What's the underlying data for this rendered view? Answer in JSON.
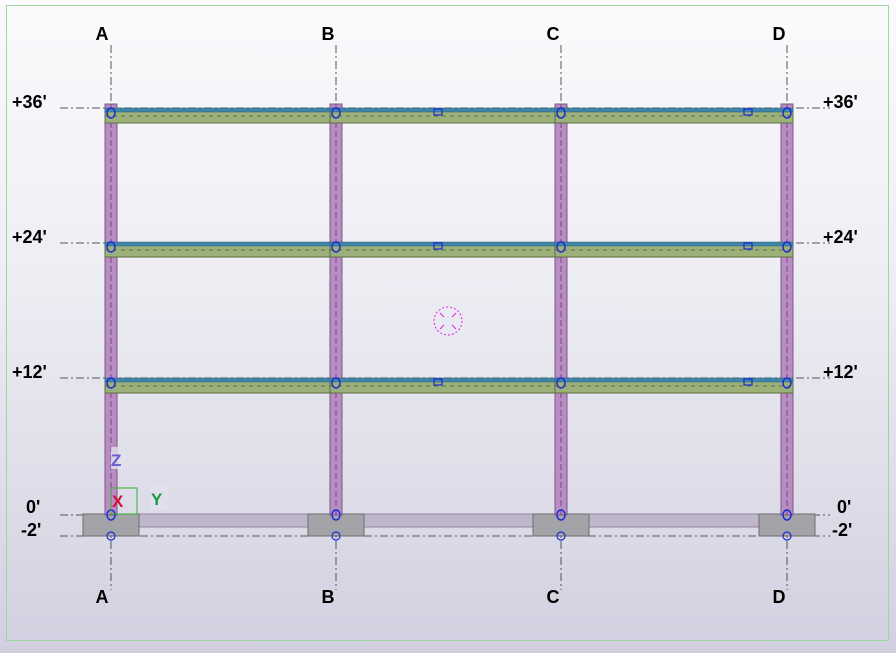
{
  "view": {
    "type": "structural elevation view",
    "background_top": "#fbfbfd",
    "background_bottom": "#d2d0e0"
  },
  "grid_lines": {
    "labels": [
      "A",
      "B",
      "C",
      "D"
    ]
  },
  "levels": {
    "labels": [
      "+36'",
      "+24'",
      "+12'",
      "0'",
      "-2'"
    ]
  },
  "axes": {
    "z": "Z",
    "x": "X",
    "y": "Y",
    "z_color": "#6a5acd",
    "x_color": "#d0103a",
    "y_color": "#1a9a3a"
  },
  "colors": {
    "column": "#b98cc4",
    "beam": "#9cb07a",
    "beam_top": "#3f86a8",
    "footing": "#a3a3a8",
    "grade_beam": "#c0b6cb",
    "node": "#1a2bd6",
    "grid_line": "#555555",
    "frame_border": "#9ed79e",
    "center_marker": "#e020e0"
  }
}
